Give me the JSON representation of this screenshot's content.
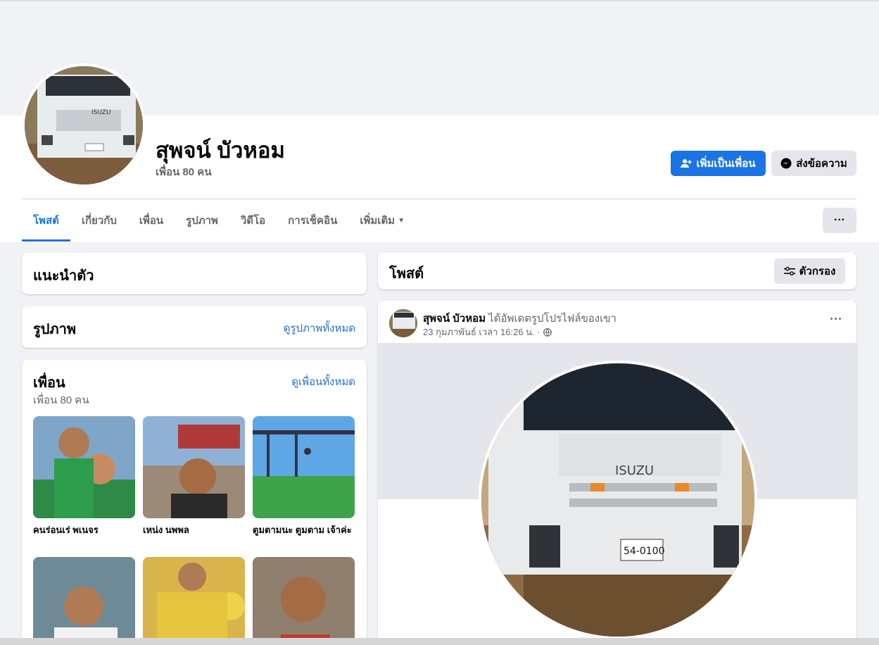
{
  "profile": {
    "name": "สุพจน์ บัวหอม",
    "friend_count": "เพื่อน 80 คน"
  },
  "actions": {
    "add_friend": "เพิ่มเป็นเพื่อน",
    "message": "ส่งข้อความ",
    "more": "···"
  },
  "tabs": [
    {
      "label": "โพสต์"
    },
    {
      "label": "เกี่ยวกับ"
    },
    {
      "label": "เพื่อน"
    },
    {
      "label": "รูปภาพ"
    },
    {
      "label": "วิดีโอ"
    },
    {
      "label": "การเช็คอิน"
    },
    {
      "label": "เพิ่มเติม"
    }
  ],
  "intro": {
    "title": "แนะนำตัว"
  },
  "photos": {
    "title": "รูปภาพ",
    "link": "ดูรูปภาพทั้งหมด"
  },
  "friends": {
    "title": "เพื่อน",
    "subtitle": "เพื่อน 80 คน",
    "link": "ดูเพื่อนทั้งหมด",
    "items": [
      {
        "name": "คนร่อนเร่ พเนจร"
      },
      {
        "name": "เหน่ง นพพล"
      },
      {
        "name": "ตูมตามนะ ตูมตาม เจ้าค่ะ"
      },
      {
        "name": ""
      },
      {
        "name": ""
      },
      {
        "name": ""
      }
    ]
  },
  "posts": {
    "title": "โพสต์",
    "filter": "ตัวกรอง"
  },
  "post": {
    "author": "สุพจน์ บัวหอม",
    "action": "ได้อัพเดตรูปโปรไฟล์ของเขา",
    "time": "23 กุมภาพันธ์ เวลา 16:26 น. ·",
    "dots": "···"
  },
  "icons": {
    "add_friend": "person-plus-icon",
    "messenger": "messenger-icon",
    "filter": "sliders-icon",
    "globe": "globe-icon",
    "caret": "caret-down-icon"
  }
}
